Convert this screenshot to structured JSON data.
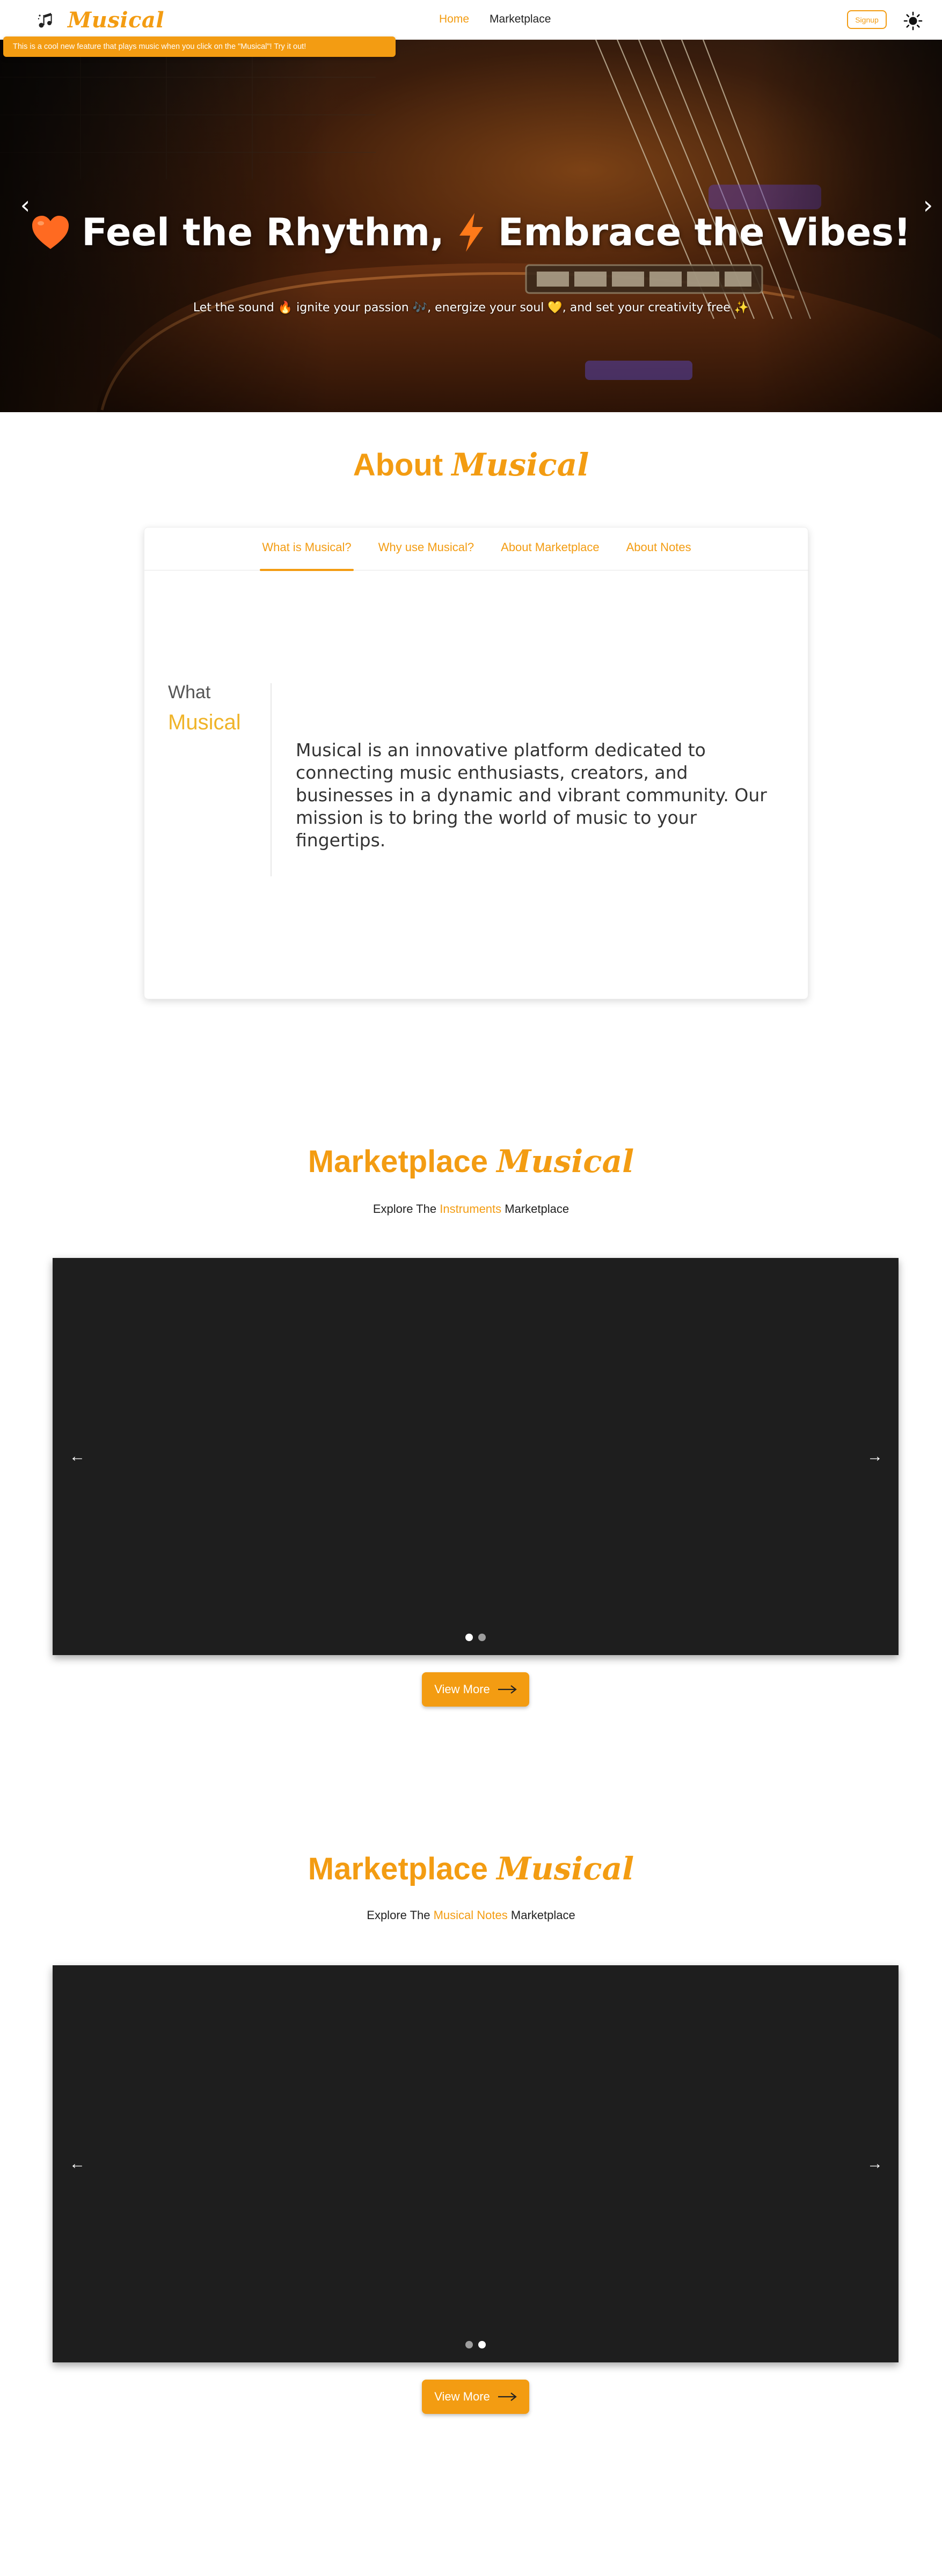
{
  "navbar": {
    "brand": "Musical",
    "brand_icon": "music-notes-icon",
    "links": [
      {
        "label": "Home",
        "active": true
      },
      {
        "label": "Marketplace",
        "active": false
      }
    ],
    "signup_label": "Signup",
    "theme_icon": "sun-icon",
    "accent_color": "#f39c12"
  },
  "toast": {
    "message": "This is a cool new feature that plays music when you click on the \"Musical\"! Try it out!"
  },
  "hero": {
    "title_part1": "Feel the Rhythm,",
    "title_part2": "Embrace the Vibes!",
    "title_icon1": "orange-heart-icon",
    "title_icon2": "lightning-icon",
    "subtitle": "Let the sound 🔥 ignite your passion 🎶, energize your soul 💛, and set your creativity free ✨",
    "prev_icon": "chevron-left-icon",
    "next_icon": "chevron-right-icon"
  },
  "about": {
    "title_prefix": "About",
    "title_brand": "Musical",
    "tabs": [
      {
        "label": "What is Musical?",
        "active": true
      },
      {
        "label": "Why use Musical?",
        "active": false
      },
      {
        "label": "About Marketplace",
        "active": false
      },
      {
        "label": "About Notes",
        "active": false
      }
    ],
    "panel_heading_1": "What",
    "panel_heading_2": "Musical",
    "panel_text": "Musical is an innovative platform dedicated to connecting music enthusiasts, creators, and businesses in a dynamic and vibrant community. Our mission is to bring the world of music to your fingertips."
  },
  "marketplace_instruments": {
    "title_prefix": "Marketplace",
    "title_brand": "Musical",
    "subtitle_before": "Explore The",
    "subtitle_highlight": "Instruments",
    "subtitle_after": "Marketplace",
    "active_slide": 1,
    "slide_count": 2,
    "view_more_label": "View More"
  },
  "marketplace_notes": {
    "title_prefix": "Marketplace",
    "title_brand": "Musical",
    "subtitle_before": "Explore The",
    "subtitle_highlight": "Musical Notes",
    "subtitle_after": "Marketplace",
    "active_slide": 2,
    "slide_count": 2,
    "view_more_label": "View More"
  }
}
